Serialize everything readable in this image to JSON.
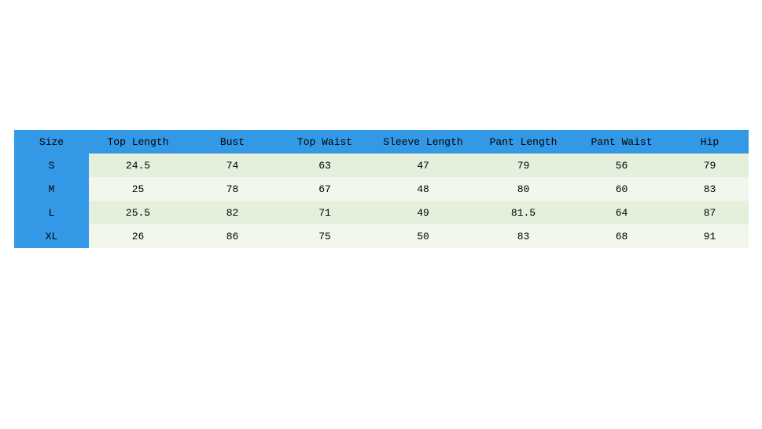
{
  "chart_data": {
    "type": "table",
    "title": "",
    "headers": [
      "Size",
      "Top Length",
      "Bust",
      "Top Waist",
      "Sleeve Length",
      "Pant Length",
      "Pant Waist",
      "Hip"
    ],
    "rows": [
      [
        "S",
        "24.5",
        "74",
        "63",
        "47",
        "79",
        "56",
        "79"
      ],
      [
        "M",
        "25",
        "78",
        "67",
        "48",
        "80",
        "60",
        "83"
      ],
      [
        "L",
        "25.5",
        "82",
        "71",
        "49",
        "81.5",
        "64",
        "87"
      ],
      [
        "XL",
        "26",
        "86",
        "75",
        "50",
        "83",
        "68",
        "91"
      ]
    ]
  }
}
